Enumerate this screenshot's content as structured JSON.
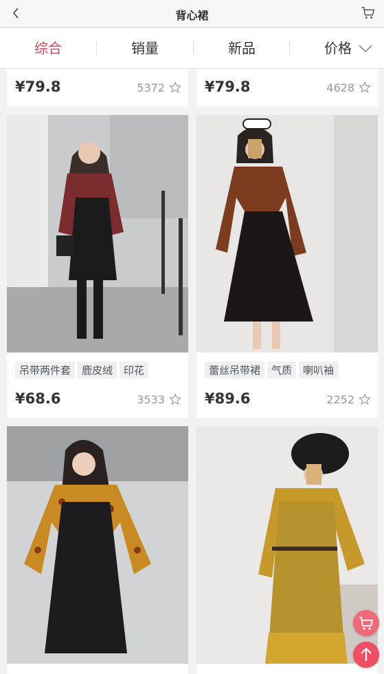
{
  "header": {
    "title": "背心裙"
  },
  "sort_tabs": [
    {
      "label": "综合",
      "active": true
    },
    {
      "label": "销量",
      "active": false
    },
    {
      "label": "新品",
      "active": false
    },
    {
      "label": "价格",
      "active": false
    }
  ],
  "colors": {
    "accent": "#e0445a",
    "fab": "#ef4f65"
  },
  "products": [
    {
      "price": "¥79.8",
      "count": "5372",
      "tags": []
    },
    {
      "price": "¥79.8",
      "count": "4628",
      "tags": []
    },
    {
      "price": "¥68.6",
      "count": "3533",
      "tags": [
        "吊带两件套",
        "鹿皮绒",
        "印花"
      ]
    },
    {
      "price": "¥89.6",
      "count": "2252",
      "tags": [
        "蕾丝吊带裙",
        "气质",
        "喇叭袖"
      ]
    },
    {
      "price": "",
      "count": "",
      "tags": []
    },
    {
      "price": "",
      "count": "",
      "tags": []
    }
  ],
  "icons": {
    "back": "chevron-left-icon",
    "cart": "shopping-cart-icon",
    "sort_price": "chevron-down-icon",
    "favorite": "star-outline-icon",
    "scroll_top": "arrow-up-icon"
  }
}
